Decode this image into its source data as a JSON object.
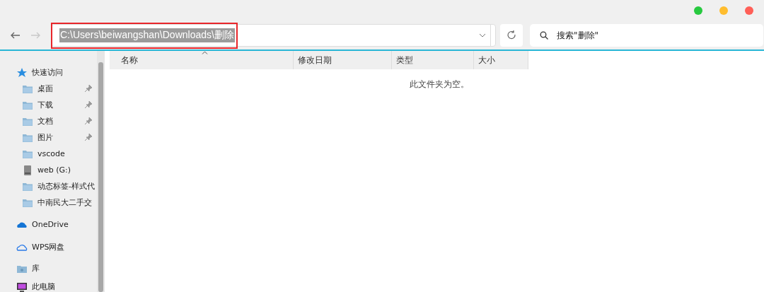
{
  "window": {
    "controls": [
      {
        "color": "#27c93f"
      },
      {
        "color": "#ffbd2e"
      },
      {
        "color": "#ff5f57"
      }
    ]
  },
  "address": {
    "value": "C:\\Users\\beiwangshan\\Downloads\\删除",
    "highlighted": true
  },
  "search": {
    "placeholder": "搜索\"删除\""
  },
  "sidebar": {
    "items": [
      {
        "label": "快速访问",
        "kind": "star",
        "children": [
          {
            "label": "桌面",
            "kind": "folder",
            "pinned": true
          },
          {
            "label": "下载",
            "kind": "folder",
            "pinned": true
          },
          {
            "label": "文档",
            "kind": "folder",
            "pinned": true
          },
          {
            "label": "图片",
            "kind": "folder",
            "pinned": true
          },
          {
            "label": "vscode",
            "kind": "folder",
            "pinned": false
          },
          {
            "label": "web (G:)",
            "kind": "drive",
            "pinned": false
          },
          {
            "label": "动态标签-样式代",
            "kind": "folder",
            "pinned": false
          },
          {
            "label": "中南民大二手交",
            "kind": "folder",
            "pinned": false
          }
        ]
      },
      {
        "label": "OneDrive",
        "kind": "onedrive"
      },
      {
        "label": "WPS网盘",
        "kind": "cloud"
      },
      {
        "label": "库",
        "kind": "library"
      },
      {
        "label": "此电脑",
        "kind": "computer"
      }
    ]
  },
  "table": {
    "columns": [
      {
        "label": "名称",
        "sorted": true
      },
      {
        "label": "修改日期",
        "sorted": false
      },
      {
        "label": "类型",
        "sorted": false
      },
      {
        "label": "大小",
        "sorted": false
      }
    ],
    "empty_message": "此文件夹为空。"
  }
}
